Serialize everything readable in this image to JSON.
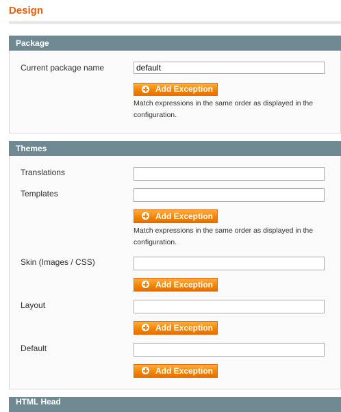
{
  "page": {
    "title": "Design"
  },
  "package": {
    "header": "Package",
    "current_package_label": "Current package name",
    "current_package_value": "default",
    "add_exception_label": "Add Exception",
    "note": "Match expressions in the same order as displayed in the configuration."
  },
  "themes": {
    "header": "Themes",
    "translations_label": "Translations",
    "translations_value": "",
    "templates_label": "Templates",
    "templates_value": "",
    "templates_note": "Match expressions in the same order as displayed in the configuration.",
    "skin_label": "Skin (Images / CSS)",
    "skin_value": "",
    "layout_label": "Layout",
    "layout_value": "",
    "default_label": "Default",
    "default_value": "",
    "add_exception_label": "Add Exception"
  },
  "html_head": {
    "header": "HTML Head"
  },
  "colors": {
    "accent": "#eb5e00",
    "header_bg": "#6f8992",
    "button": "#f18200"
  }
}
